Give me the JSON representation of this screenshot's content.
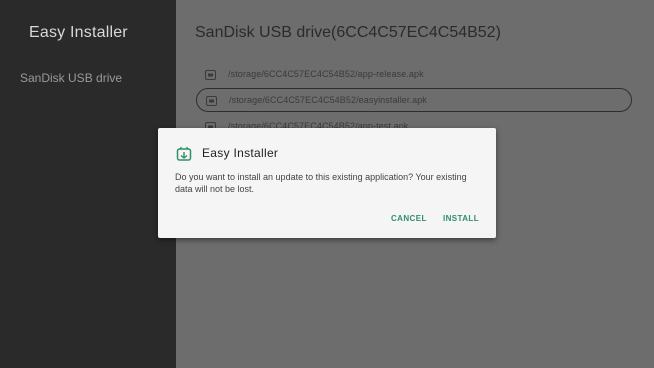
{
  "app": {
    "title": "Easy Installer"
  },
  "sidebar": {
    "items": [
      {
        "label": "SanDisk USB drive"
      }
    ]
  },
  "main": {
    "drive_title": "SanDisk USB drive(6CC4C57EC4C54B52)",
    "files": [
      {
        "path": "/storage/6CC4C57EC4C54B52/app-release.apk",
        "icon": "apk-file-icon"
      },
      {
        "path": "/storage/6CC4C57EC4C54B52/easyinstaller.apk",
        "icon": "apk-file-icon"
      },
      {
        "path": "/storage/6CC4C57EC4C54B52/app-test.apk",
        "icon": "apk-file-icon"
      }
    ]
  },
  "dialog": {
    "title": "Easy Installer",
    "message": "Do you want to install an update to this existing application? Your existing data will not be lost.",
    "cancel_label": "CANCEL",
    "install_label": "INSTALL",
    "icon": "android-package-icon"
  },
  "colors": {
    "accent": "#2f8f6b",
    "sidebar_bg": "#2a2a2a",
    "scrim_bg": "#6d6d6d",
    "dialog_bg": "#f5f5f5"
  }
}
